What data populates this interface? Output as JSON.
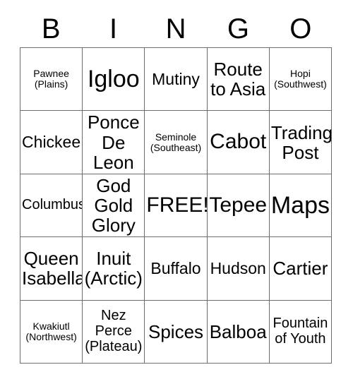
{
  "card": {
    "header_letters": [
      "B",
      "I",
      "N",
      "G",
      "O"
    ],
    "free_space_label": "FREE!",
    "colors": {
      "background": "#ffffff",
      "grid_line": "#6d6d6d",
      "text": "#000000"
    },
    "rows": [
      [
        {
          "text": "Pawnee\n(Plains)"
        },
        {
          "text": "Igloo"
        },
        {
          "text": "Mutiny"
        },
        {
          "text": "Route\nto Asia"
        },
        {
          "text": "Hopi\n(Southwest)"
        }
      ],
      [
        {
          "text": "Chickee"
        },
        {
          "text": "Ponce\nDe\nLeon"
        },
        {
          "text": "Seminole\n(Southeast)"
        },
        {
          "text": "Cabot"
        },
        {
          "text": "Trading\nPost"
        }
      ],
      [
        {
          "text": "Columbus"
        },
        {
          "text": "God\nGold\nGlory"
        },
        {
          "text": "FREE!"
        },
        {
          "text": "Tepee"
        },
        {
          "text": "Maps"
        }
      ],
      [
        {
          "text": "Queen\nIsabella"
        },
        {
          "text": "Inuit\n(Arctic)"
        },
        {
          "text": "Buffalo"
        },
        {
          "text": "Hudson"
        },
        {
          "text": "Cartier"
        }
      ],
      [
        {
          "text": "Kwakiutl\n(Northwest)"
        },
        {
          "text": "Nez\nPerce\n(Plateau)"
        },
        {
          "text": "Spices"
        },
        {
          "text": "Balboa"
        },
        {
          "text": "Fountain\nof Youth"
        }
      ]
    ]
  }
}
